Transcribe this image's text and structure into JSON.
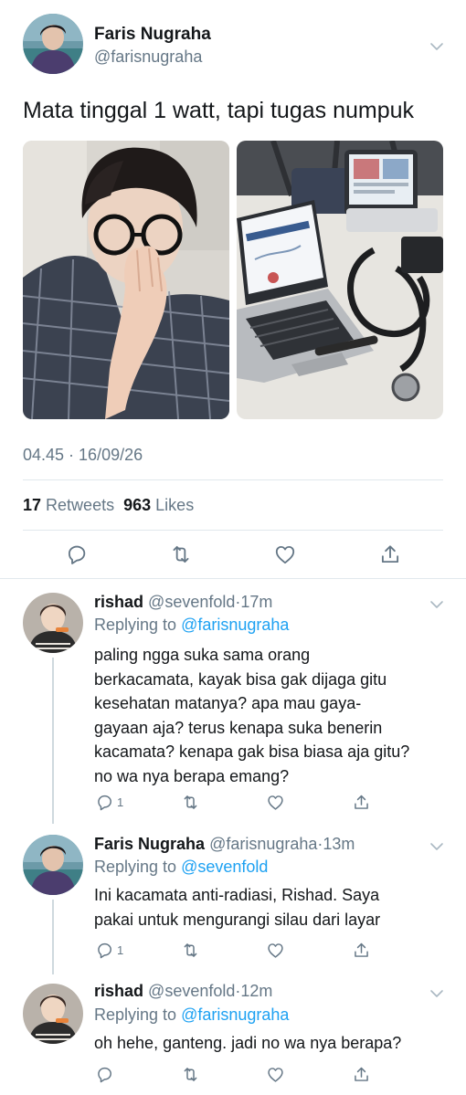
{
  "main_tweet": {
    "author_name": "Faris Nugraha",
    "author_handle": "@farisnugraha",
    "text": "Mata tinggal 1 watt, tapi tugas numpuk",
    "timestamp": "04.45 · 16/09/26",
    "retweets_count": "17",
    "retweets_label": "Retweets",
    "likes_count": "963",
    "likes_label": "Likes"
  },
  "replies": [
    {
      "name": "rishad",
      "handle": "@sevenfold",
      "time": "17m",
      "replying_prefix": "Replying to",
      "replying_to": "@farisnugraha",
      "lines": [
        "paling ngga suka sama orang",
        "berkacamata, kayak bisa gak dijaga gitu",
        "kesehatan matanya? apa mau gaya-",
        "gayaan aja? terus kenapa suka benerin",
        "kacamata? kenapa gak bisa biasa aja gitu?",
        "no wa nya berapa emang?"
      ],
      "reply_count": "1"
    },
    {
      "name": "Faris Nugraha",
      "handle": "@farisnugraha",
      "time": "13m",
      "replying_prefix": "Replying to",
      "replying_to": "@sevenfold",
      "lines": [
        "Ini kacamata anti-radiasi, Rishad. Saya",
        "pakai untuk mengurangi silau dari layar"
      ],
      "reply_count": "1"
    },
    {
      "name": "rishad",
      "handle": "@sevenfold",
      "time": "12m",
      "replying_prefix": "Replying to",
      "replying_to": "@farisnugraha",
      "lines": [
        "oh hehe, ganteng. jadi no wa nya berapa?"
      ],
      "reply_count": ""
    }
  ],
  "icons": {
    "reply": "reply-icon",
    "retweet": "retweet-icon",
    "like": "heart-icon",
    "share": "share-icon",
    "more": "chevron-down-icon"
  },
  "colors": {
    "link_blue": "#1da1f2",
    "secondary_gray": "#657786",
    "divider": "#e1e8ed"
  }
}
